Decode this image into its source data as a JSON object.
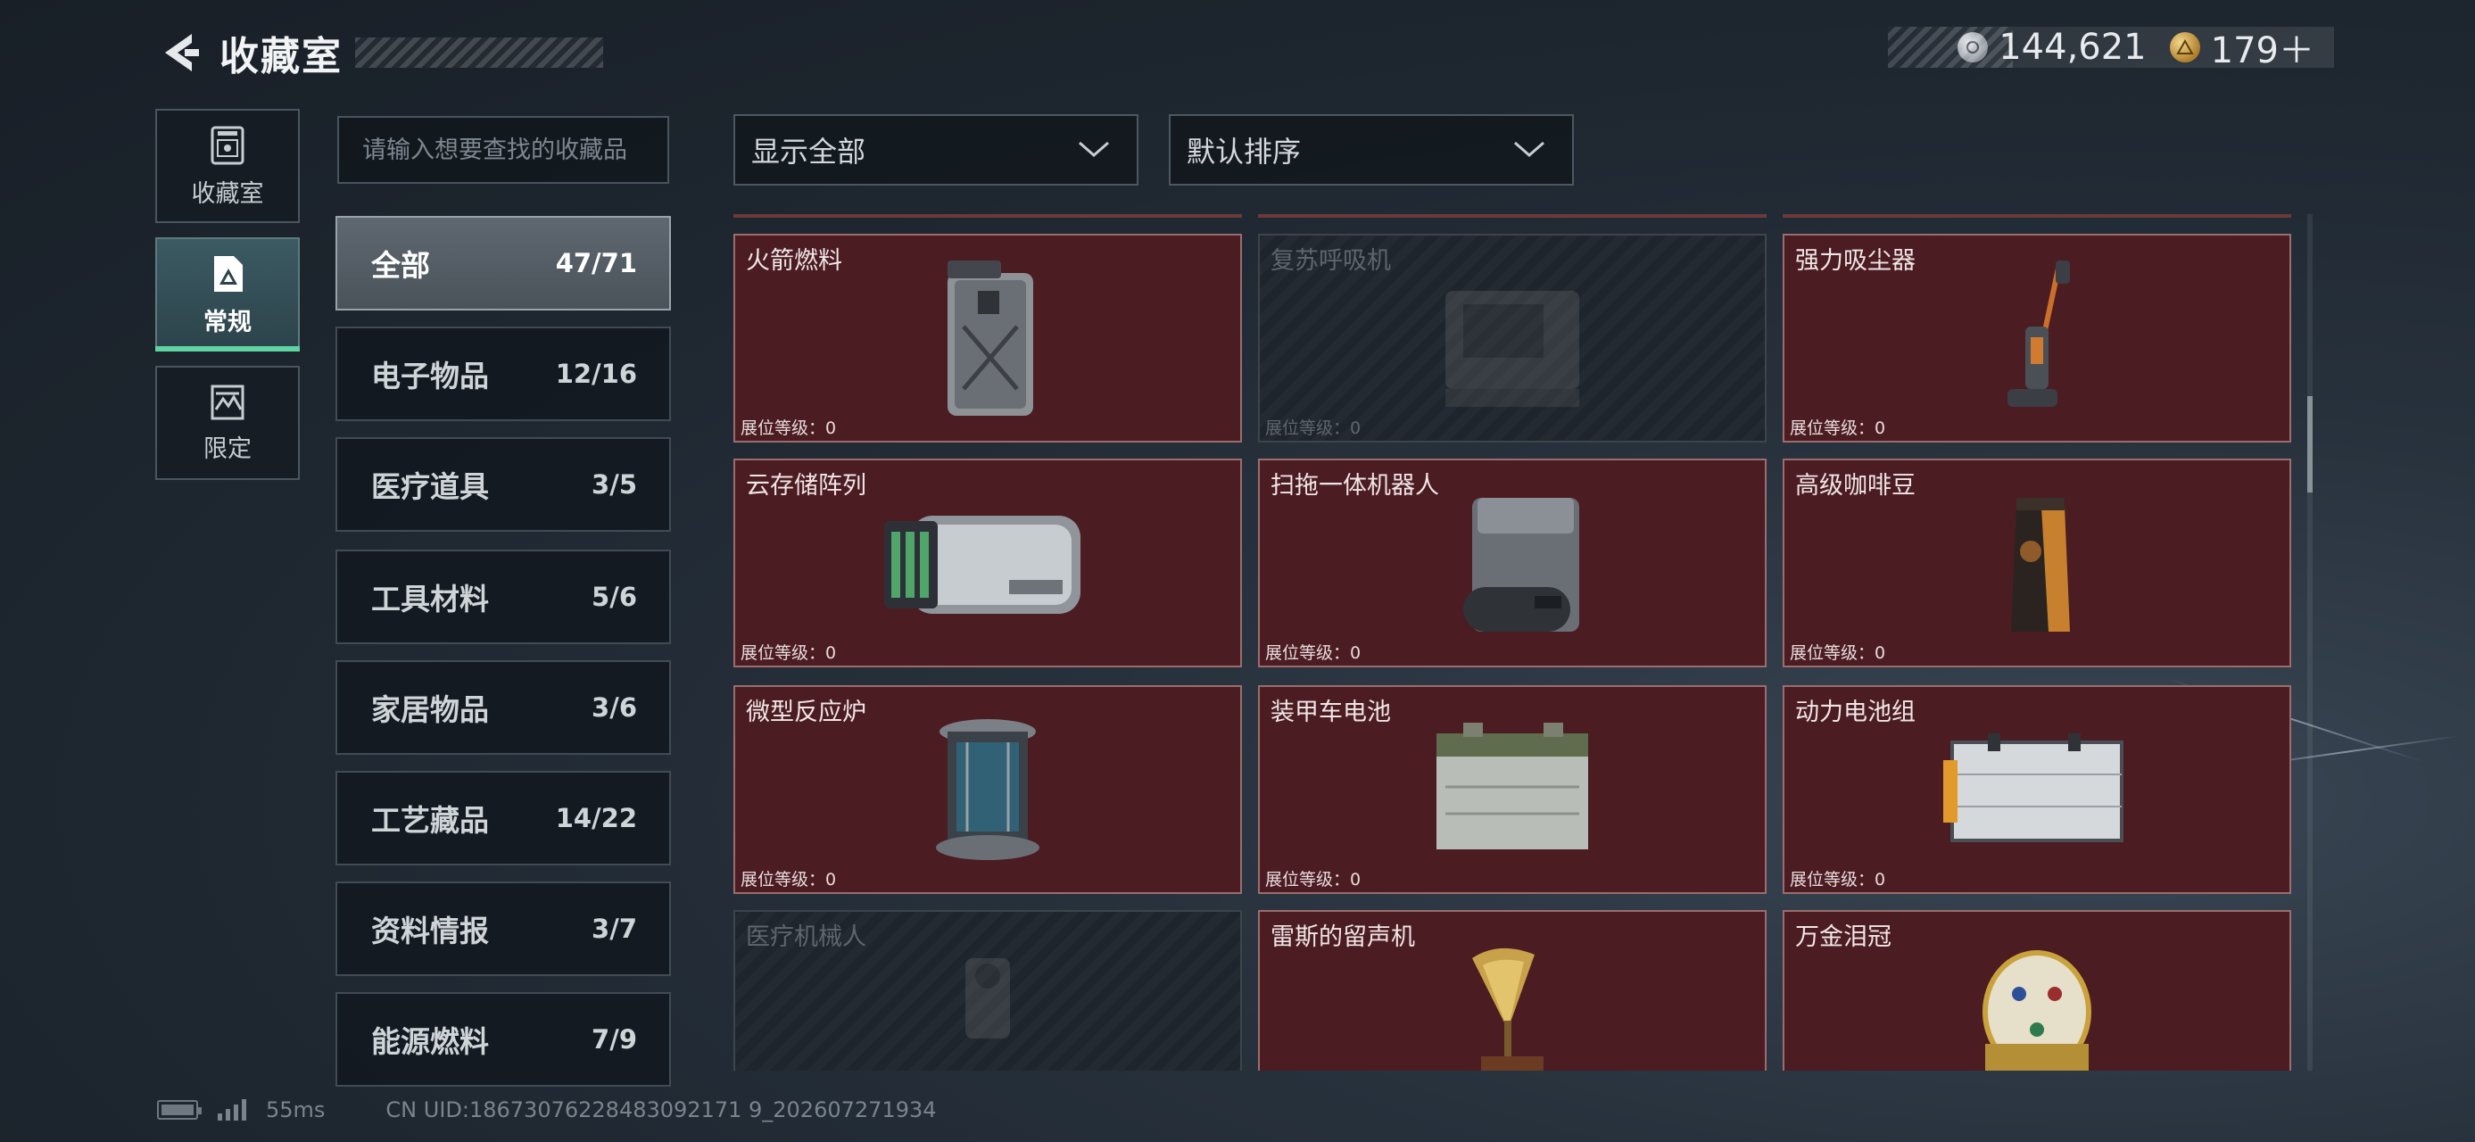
{
  "header": {
    "title": "收藏室",
    "currency": [
      {
        "icon": "silver-coin-icon",
        "value": "144,621",
        "color": "#b8bcc4"
      },
      {
        "icon": "gold-triangle-coin-icon",
        "value": "179＋",
        "color": "#d8a94a"
      }
    ]
  },
  "rail": [
    {
      "label": "收藏室",
      "icon": "vault-icon"
    },
    {
      "label": "常规",
      "icon": "document-icon"
    },
    {
      "label": "限定",
      "icon": "limited-icon"
    }
  ],
  "search": {
    "placeholder": "请输入想要查找的收藏品"
  },
  "categories": [
    {
      "name": "全部",
      "count": "47/71"
    },
    {
      "name": "电子物品",
      "count": "12/16"
    },
    {
      "name": "医疗道具",
      "count": "3/5"
    },
    {
      "name": "工具材料",
      "count": "5/6"
    },
    {
      "name": "家居物品",
      "count": "3/6"
    },
    {
      "name": "工艺藏品",
      "count": "14/22"
    },
    {
      "name": "资料情报",
      "count": "3/7"
    },
    {
      "name": "能源燃料",
      "count": "7/9"
    }
  ],
  "filters": {
    "display": "显示全部",
    "sort": "默认排序"
  },
  "items": [
    {
      "name": "火箭燃料",
      "level_label": "展位等级：",
      "level": "0",
      "locked": false,
      "icon": "fuel-jerrycan-icon"
    },
    {
      "name": "复苏呼吸机",
      "level_label": "展位等级：",
      "level": "0",
      "locked": true,
      "icon": "ventilator-icon"
    },
    {
      "name": "强力吸尘器",
      "level_label": "展位等级：",
      "level": "0",
      "locked": false,
      "icon": "vacuum-cleaner-icon"
    },
    {
      "name": "云存储阵列",
      "level_label": "展位等级：",
      "level": "0",
      "locked": false,
      "icon": "storage-array-icon"
    },
    {
      "name": "扫拖一体机器人",
      "level_label": "展位等级：",
      "level": "0",
      "locked": false,
      "icon": "robot-vacuum-station-icon"
    },
    {
      "name": "高级咖啡豆",
      "level_label": "展位等级：",
      "level": "0",
      "locked": false,
      "icon": "coffee-bag-icon"
    },
    {
      "name": "微型反应炉",
      "level_label": "展位等级：",
      "level": "0",
      "locked": false,
      "icon": "mini-reactor-icon"
    },
    {
      "name": "装甲车电池",
      "level_label": "展位等级：",
      "level": "0",
      "locked": false,
      "icon": "vehicle-battery-icon"
    },
    {
      "name": "动力电池组",
      "level_label": "展位等级：",
      "level": "0",
      "locked": false,
      "icon": "battery-pack-icon"
    },
    {
      "name": "医疗机械人",
      "level_label": "",
      "level": "",
      "locked": true,
      "icon": "medical-robot-icon"
    },
    {
      "name": "雷斯的留声机",
      "level_label": "",
      "level": "",
      "locked": false,
      "icon": "gramophone-icon"
    },
    {
      "name": "万金泪冠",
      "level_label": "",
      "level": "",
      "locked": false,
      "icon": "jeweled-egg-icon"
    }
  ],
  "footer": {
    "ping": "55ms",
    "uid": "CN UID:18673076228483092171 9_202607271934"
  }
}
